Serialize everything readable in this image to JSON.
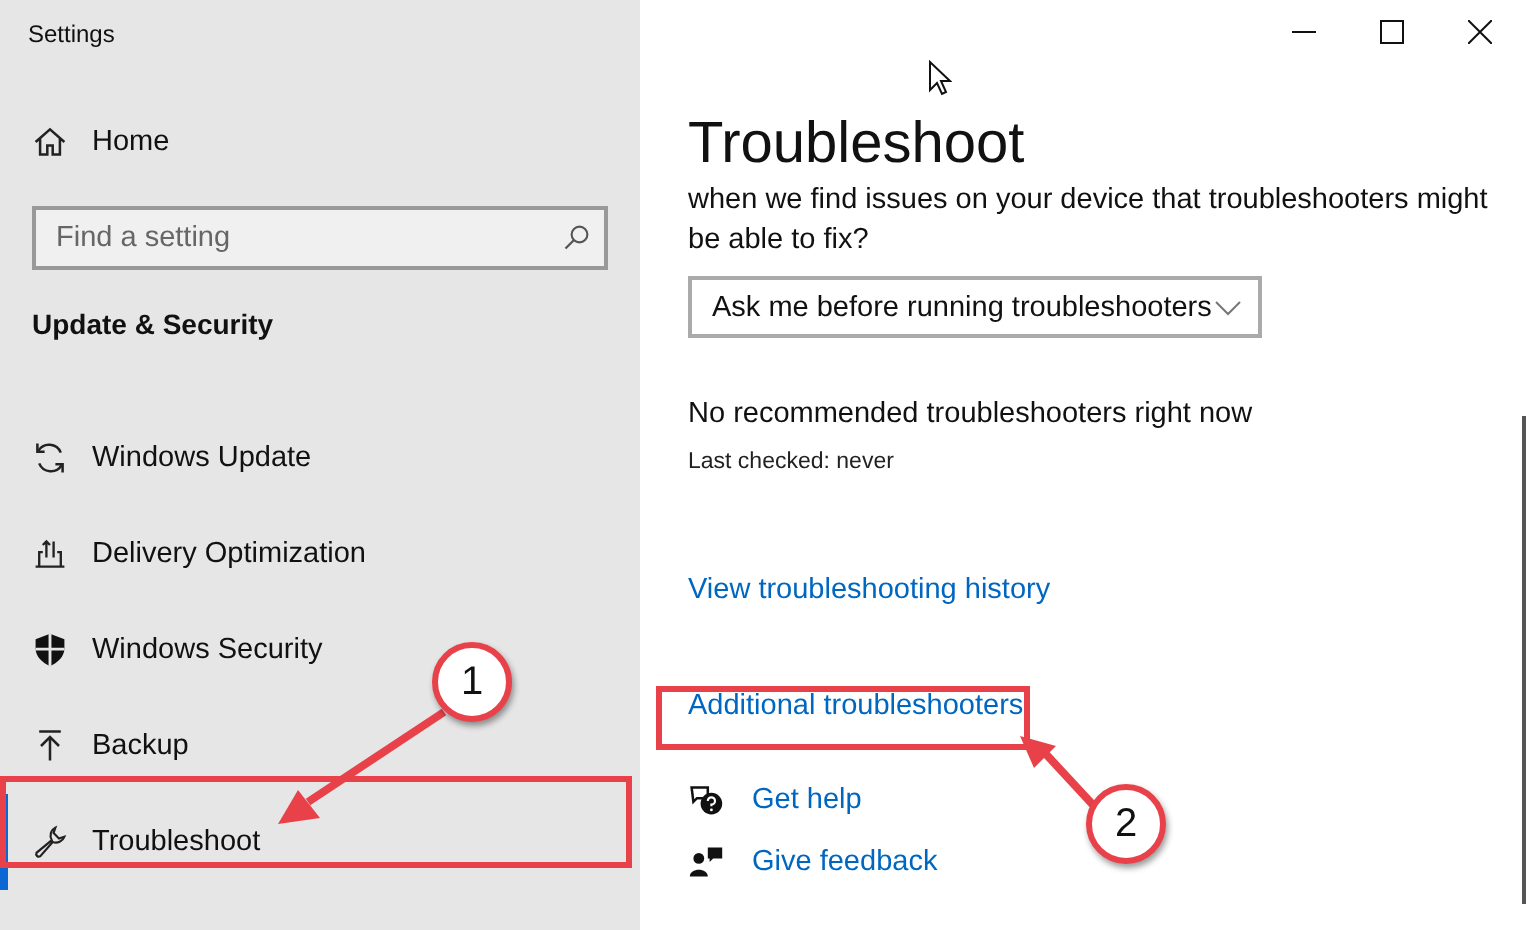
{
  "window": {
    "title": "Settings"
  },
  "sidebar": {
    "home": "Home",
    "search": {
      "placeholder": "Find a setting"
    },
    "section": "Update & Security",
    "items": [
      {
        "label": "Windows Update",
        "selected": false
      },
      {
        "label": "Delivery Optimization",
        "selected": false
      },
      {
        "label": "Windows Security",
        "selected": false
      },
      {
        "label": "Backup",
        "selected": false
      },
      {
        "label": "Troubleshoot",
        "selected": true
      }
    ]
  },
  "main": {
    "title": "Troubleshoot",
    "question": "when we find issues on your device that troubleshooters might be able to fix?",
    "dropdown": {
      "value": "Ask me before running troubleshooters"
    },
    "status": "No recommended troubleshooters right now",
    "last_checked": "Last checked: never",
    "links": [
      "View troubleshooting history",
      "Additional troubleshooters"
    ],
    "help": [
      "Get help",
      "Give feedback"
    ]
  },
  "annotations": [
    {
      "number": "1"
    },
    {
      "number": "2"
    }
  ]
}
